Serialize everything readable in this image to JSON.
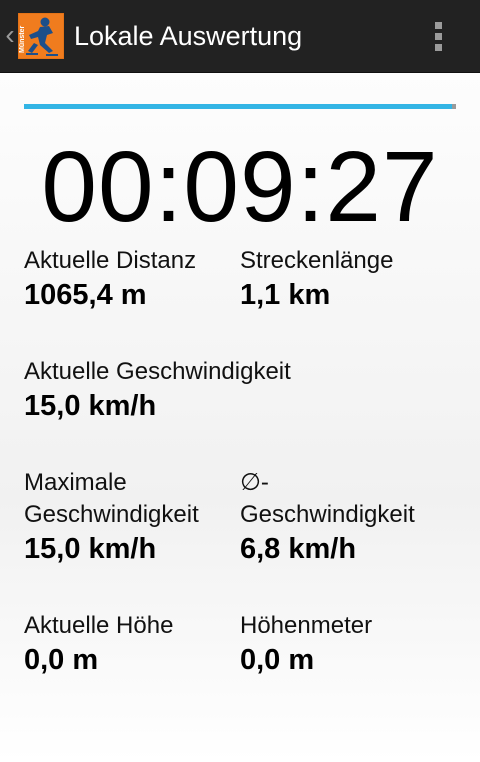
{
  "header": {
    "title": "Lokale Auswertung",
    "logo_text": "Münster",
    "up_icon": "chevron-left-icon",
    "menu_icon": "overflow-menu-icon"
  },
  "progress": {
    "fraction": 0.99,
    "fill_color": "#33b5e5",
    "track_color": "#9a9a9a"
  },
  "timer": "00:09:27",
  "stats": {
    "current_distance": {
      "label": "Aktuelle Distanz",
      "value": "1065,4 m"
    },
    "track_length": {
      "label": "Streckenlänge",
      "value": "1,1 km"
    },
    "current_speed": {
      "label": "Aktuelle Geschwindigkeit",
      "value": "15,0 km/h"
    },
    "max_speed": {
      "label_line1": "Maximale",
      "label_line2": "Geschwindigkeit",
      "value": "15,0 km/h"
    },
    "avg_speed": {
      "label_line1": "∅-",
      "label_line2": "Geschwindigkeit",
      "value": "6,8 km/h"
    },
    "current_altitude": {
      "label": "Aktuelle Höhe",
      "value": "0,0 m"
    },
    "elevation_gain": {
      "label": "Höhenmeter",
      "value": "0,0 m"
    }
  }
}
